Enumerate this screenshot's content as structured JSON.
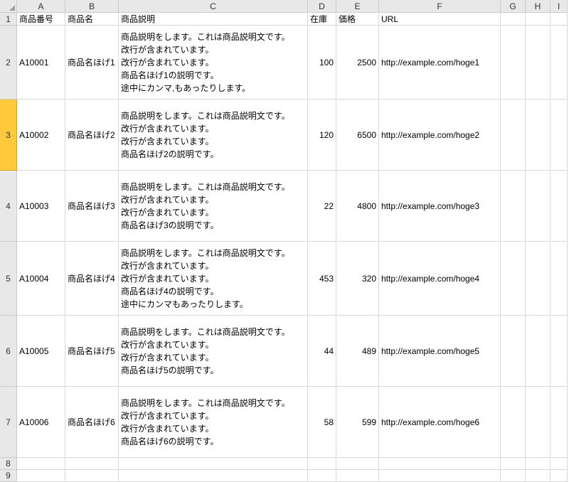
{
  "columns": [
    "A",
    "B",
    "C",
    "D",
    "E",
    "F",
    "G",
    "H",
    "I"
  ],
  "header_row_index": 1,
  "headers": {
    "a": "商品番号",
    "b": "商品名",
    "c": "商品説明",
    "d": "在庫",
    "e": "価格",
    "f": "URL"
  },
  "selected_row": 3,
  "rows": [
    {
      "idx": 2,
      "a": "A10001",
      "b": "商品名ほげ1",
      "c": "商品説明をします。これは商品説明文です。\n改行が含まれています。\n改行が含まれています。\n商品名ほげ1の説明です。\n途中にカンマ,もあったりします。",
      "d": "100",
      "e": "2500",
      "f": "http://example.com/hoge1"
    },
    {
      "idx": 3,
      "a": "A10002",
      "b": "商品名ほげ2",
      "c": "商品説明をします。これは商品説明文です。\n改行が含まれています。\n改行が含まれています。\n商品名ほげ2の説明です。",
      "d": "120",
      "e": "6500",
      "f": "http://example.com/hoge2"
    },
    {
      "idx": 4,
      "a": "A10003",
      "b": "商品名ほげ3",
      "c": "商品説明をします。これは商品説明文です。\n改行が含まれています。\n改行が含まれています。\n商品名ほげ3の説明です。",
      "d": "22",
      "e": "4800",
      "f": "http://example.com/hoge3"
    },
    {
      "idx": 5,
      "a": "A10004",
      "b": "商品名ほげ4",
      "c": "商品説明をします。これは商品説明文です。\n改行が含まれています。\n改行が含まれています。\n商品名ほげ4の説明です。\n途中にカンマもあったりします。",
      "d": "453",
      "e": "320",
      "f": "http://example.com/hoge4"
    },
    {
      "idx": 6,
      "a": "A10005",
      "b": "商品名ほげ5",
      "c": "商品説明をします。これは商品説明文です。\n改行が含まれています。\n改行が含まれています。\n商品名ほげ5の説明です。",
      "d": "44",
      "e": "489",
      "f": "http://example.com/hoge5"
    },
    {
      "idx": 7,
      "a": "A10006",
      "b": "商品名ほげ6",
      "c": "商品説明をします。これは商品説明文です。\n改行が含まれています。\n改行が含まれています。\n商品名ほげ6の説明です。",
      "d": "58",
      "e": "599",
      "f": "http://example.com/hoge6"
    }
  ],
  "empty_rows": [
    8,
    9
  ]
}
